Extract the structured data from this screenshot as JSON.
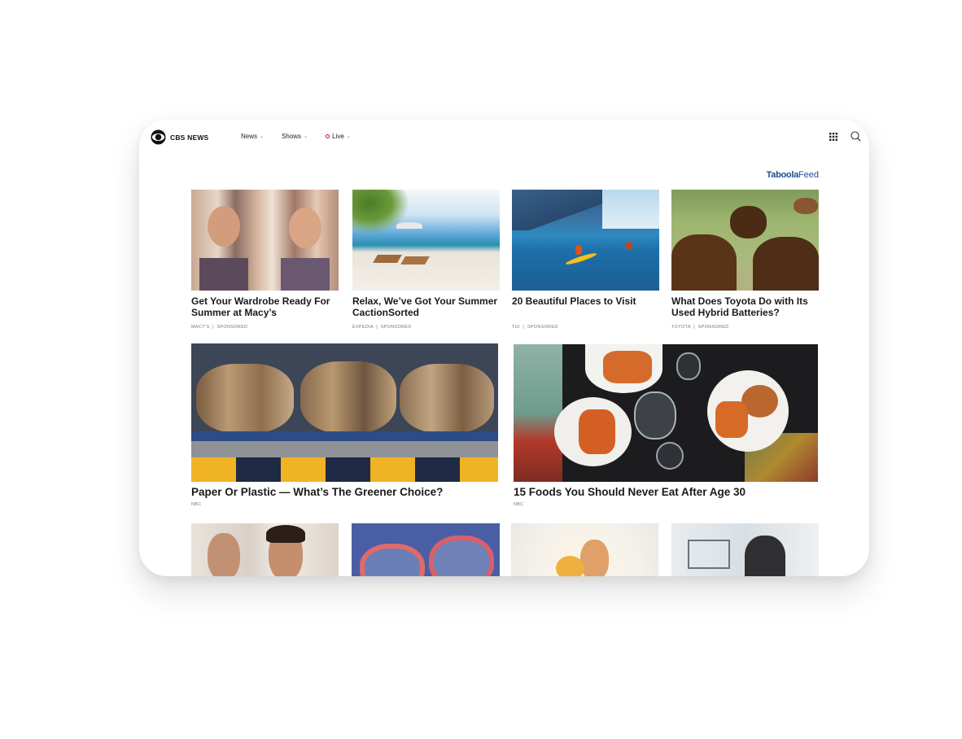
{
  "header": {
    "brand": "CBS NEWS",
    "nav": [
      {
        "label": "News",
        "chevron": "⌄"
      },
      {
        "label": "Shows",
        "chevron": "⌄"
      },
      {
        "label": "Live",
        "chevron": "⌄",
        "indicator": "live-dot"
      }
    ],
    "icons": [
      "apps-grid-icon",
      "search-icon"
    ]
  },
  "feed": {
    "provider_bold": "Taboola",
    "provider_light": "Feed",
    "row1": [
      {
        "title": "Get Your Wardrobe Ready For Summer at Macy’s",
        "source": "MACY'S",
        "tag": "SPONSORED",
        "image": "two women smiling among clothing racks"
      },
      {
        "title": "Relax, We’ve Got Your Summer CactionSorted",
        "source": "EXPEDIA",
        "tag": "SPONSORED",
        "image": "beach loungers under palm tree"
      },
      {
        "title": "20 Beautiful Places to Visit",
        "source": "TUI",
        "tag": "SPONSORED",
        "image": "kayakers on blue sea near cliffs"
      },
      {
        "title": "What Does Toyota Do with Its Used Hybrid Batteries?",
        "source": "TOYOTA",
        "tag": "SPONSORED",
        "image": "bison grazing in grassland"
      }
    ],
    "row2": [
      {
        "title": "Paper Or Plastic — What’s The Greener Choice?",
        "source": "NBC",
        "image": "bales of recycled cardboard"
      },
      {
        "title": "15 Foods You Should Never Eat After Age 30",
        "source": "NBC",
        "image": "burgers and fries on table"
      }
    ],
    "row3": [
      {
        "image": "couple shaving in bathroom"
      },
      {
        "image": "sunglasses on blue background"
      },
      {
        "image": "woman laughing in sunlight"
      },
      {
        "image": "man facing whiteboard wall"
      }
    ],
    "separator": "|"
  },
  "colors": {
    "live": "#c8102e",
    "taboola": "#1f4d8f",
    "title": "#1a1a1a"
  }
}
